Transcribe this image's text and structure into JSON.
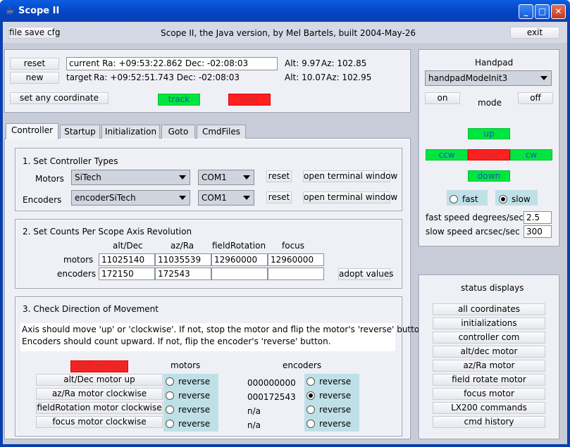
{
  "window": {
    "title": "Scope II",
    "minimize": "_",
    "maximize": "□",
    "close": "✕"
  },
  "top": {
    "file_btn": "file save cfg",
    "caption": "Scope II, the Java version, by Mel Bartels, built 2004-May-26",
    "exit_btn": "exit"
  },
  "coords": {
    "reset_btn": "reset",
    "new_btn": "new",
    "current": "current Ra: +09:53:22.862 Dec: -02:08:03",
    "target_label": "target",
    "target": "Ra: +09:52:51.743 Dec: -02:08:03",
    "alt_cur": "Alt: 9.97",
    "az_cur": "Az: 102.85",
    "alt_tgt": "Alt: 10.07",
    "az_tgt": "Az: 102.95",
    "set_any_btn": "set any coordinate",
    "track_btn": "track",
    "stop_btn": "stop"
  },
  "tabs": [
    "Controller",
    "Startup",
    "Initialization",
    "Goto",
    "CmdFiles"
  ],
  "section1": {
    "title": "1.   Set Controller Types",
    "motors_label": "Motors",
    "motors_value": "SiTech",
    "motors_port": "COM1",
    "encoders_label": "Encoders",
    "encoders_value": "encoderSiTech",
    "encoders_port": "COM1",
    "reset_btn": "reset",
    "terminal_btn": "open terminal window"
  },
  "section2": {
    "title": "2.   Set Counts Per Scope Axis Revolution",
    "headers": [
      "alt/Dec",
      "az/Ra",
      "fieldRotation",
      "focus"
    ],
    "motors_label": "motors",
    "encoders_label": "encoders",
    "motors_values": [
      "11025140",
      "11035539",
      "12960000",
      "12960000"
    ],
    "encoders_values": [
      "172150",
      "172543",
      "",
      ""
    ],
    "adopt_btn": "adopt values"
  },
  "section3": {
    "title": "3.   Check Direction of Movement",
    "note1": "Axis should move 'up' or 'clockwise'.  If not, stop the motor and flip the motor's 'reverse' button.",
    "note2": "Encoders should count upward.  If not, flip the encoder's 'reverse' button.",
    "stop_btn": "stop motors",
    "motors_header": "motors",
    "encoders_header": "encoders",
    "rows": [
      {
        "btn": "alt/Dec motor up",
        "motor_rev": "reverse",
        "enc_value": "000000000",
        "enc_rev": "reverse"
      },
      {
        "btn": "az/Ra motor clockwise",
        "motor_rev": "reverse",
        "enc_value": "000172543",
        "enc_rev": "reverse"
      },
      {
        "btn": "fieldRotation motor clockwise",
        "motor_rev": "reverse",
        "enc_value": "n/a",
        "enc_rev": "reverse"
      },
      {
        "btn": "focus motor clockwise",
        "motor_rev": "reverse",
        "enc_value": "n/a",
        "enc_rev": "reverse"
      }
    ]
  },
  "handpad": {
    "title": "Handpad",
    "mode_value": "handpadModeInit3",
    "on_btn": "on",
    "mode_label": "mode",
    "off_btn": "off",
    "up_btn": "up",
    "ccw_btn": "ccw",
    "stop_btn": "stop",
    "cw_btn": "cw",
    "down_btn": "down",
    "fast_label": "fast",
    "slow_label": "slow",
    "fast_speed_label": "fast speed degrees/sec",
    "fast_speed_value": "2.5",
    "slow_speed_label": "slow speed arcsec/sec",
    "slow_speed_value": "300"
  },
  "status": {
    "title": "status displays",
    "buttons": [
      "all coordinates",
      "initializations",
      "controller com",
      "alt/dec motor",
      "az/Ra motor",
      "field rotate motor",
      "focus motor",
      "LX200 commands",
      "cmd history"
    ]
  }
}
